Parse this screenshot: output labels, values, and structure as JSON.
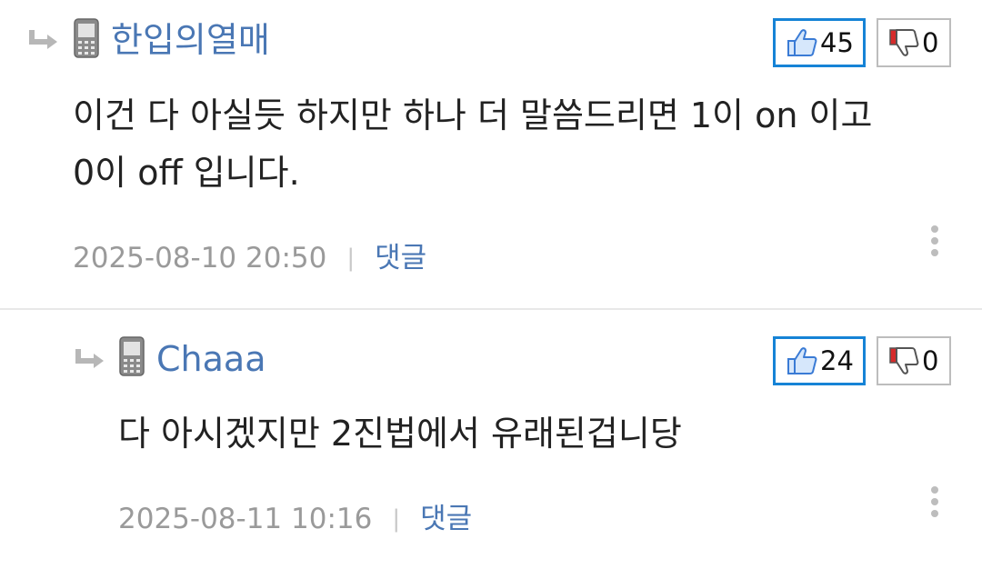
{
  "comments": [
    {
      "username": "한입의열매",
      "text_lines": [
        "이건 다 아실듯 하지만 하나 더 말씀드리면 1이 on 이고",
        "0이 off 입니다."
      ],
      "timestamp": "2025-08-10 20:50",
      "separator": "|",
      "reply_label": "댓글",
      "likes": "45",
      "dislikes": "0"
    },
    {
      "username": "Chaaa",
      "text_lines": [
        "다 아시겠지만 2진법에서 유래된겁니당"
      ],
      "timestamp": "2025-08-11 10:16",
      "separator": "|",
      "reply_label": "댓글",
      "likes": "24",
      "dislikes": "0"
    }
  ],
  "colors": {
    "username": "#4a77b4",
    "like_border": "#1683d6",
    "dislike_border": "#bdbdbd",
    "meta_text": "#9a9a9a",
    "dislike_accent": "#d62b2b"
  },
  "icons": [
    "reply-arrow-icon",
    "mobile-phone-icon",
    "thumbs-up-icon",
    "thumbs-down-icon",
    "more-options-icon"
  ]
}
